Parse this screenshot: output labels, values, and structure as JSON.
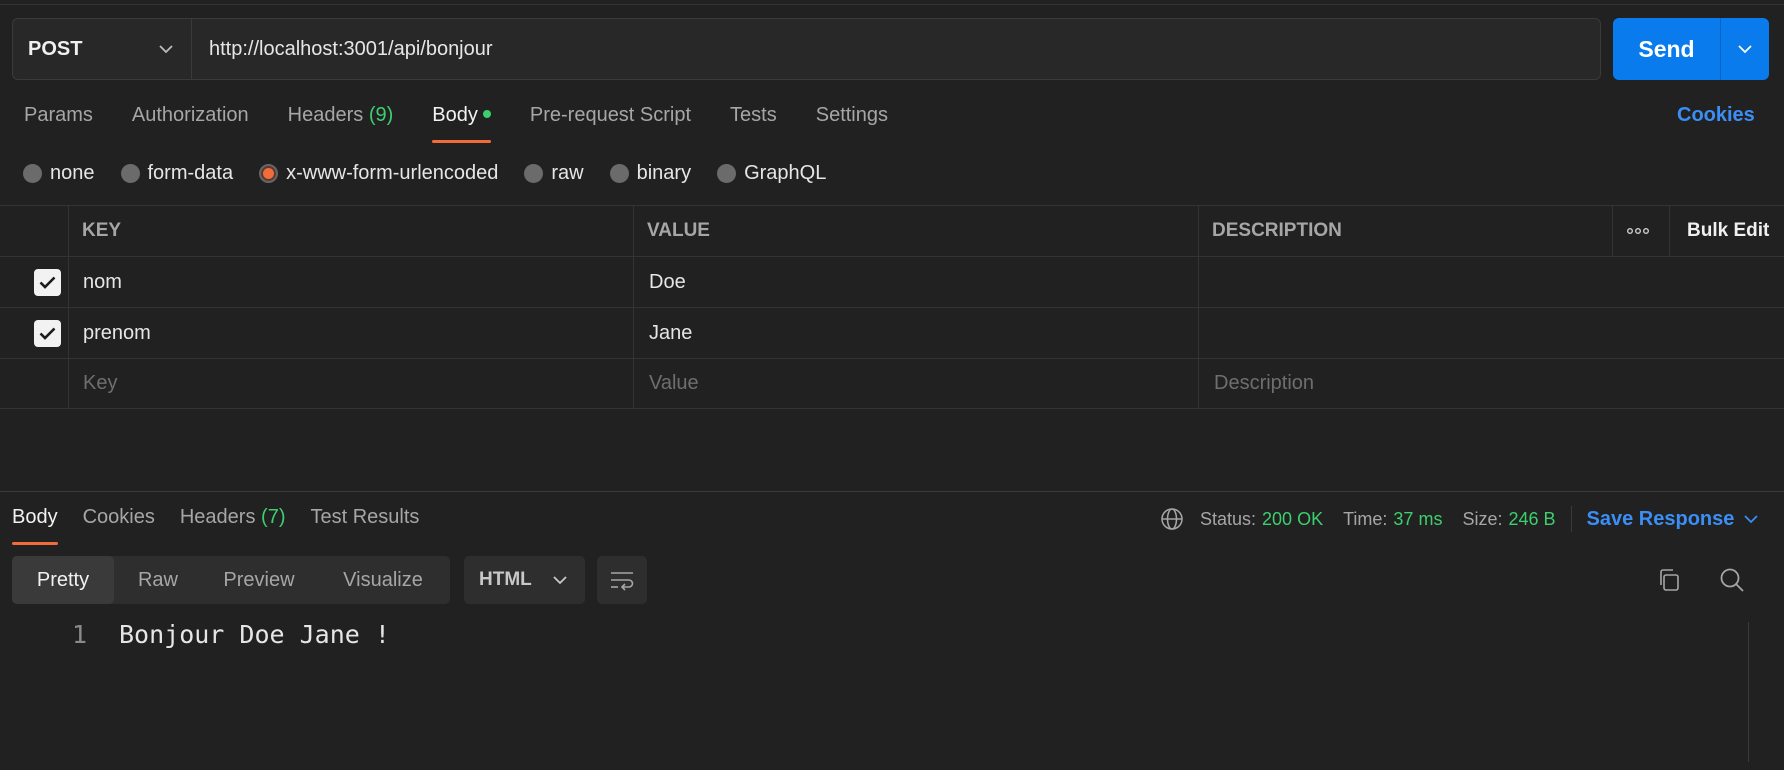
{
  "request": {
    "method": "POST",
    "url": "http://localhost:3001/api/bonjour",
    "send_label": "Send"
  },
  "request_tabs": {
    "params": "Params",
    "authorization": "Authorization",
    "headers": "Headers",
    "headers_count": "(9)",
    "body": "Body",
    "pre_request": "Pre-request Script",
    "tests": "Tests",
    "settings": "Settings",
    "cookies": "Cookies"
  },
  "body_types": {
    "none": "none",
    "form_data": "form-data",
    "urlencoded": "x-www-form-urlencoded",
    "raw": "raw",
    "binary": "binary",
    "graphql": "GraphQL",
    "selected": "x-www-form-urlencoded"
  },
  "table": {
    "key_header": "KEY",
    "value_header": "VALUE",
    "description_header": "DESCRIPTION",
    "bulk_edit": "Bulk Edit",
    "rows": [
      {
        "key": "nom",
        "value": "Doe",
        "description": "",
        "checked": true
      },
      {
        "key": "prenom",
        "value": "Jane",
        "description": "",
        "checked": true
      }
    ],
    "placeholder": {
      "key": "Key",
      "value": "Value",
      "description": "Description"
    }
  },
  "response_tabs": {
    "body": "Body",
    "cookies": "Cookies",
    "headers": "Headers",
    "headers_count": "(7)",
    "test_results": "Test Results"
  },
  "status": {
    "status_label": "Status:",
    "status_value": "200 OK",
    "time_label": "Time:",
    "time_value": "37 ms",
    "size_label": "Size:",
    "size_value": "246 B",
    "save_response": "Save Response"
  },
  "view": {
    "pretty": "Pretty",
    "raw": "Raw",
    "preview": "Preview",
    "visualize": "Visualize",
    "language": "HTML"
  },
  "response_body": {
    "line_number": "1",
    "text": "Bonjour Doe Jane !"
  },
  "colors": {
    "accent": "#f26b3a",
    "send": "#097bed",
    "link": "#3b8ef5",
    "success": "#3ccf6e",
    "background": "#212121"
  }
}
